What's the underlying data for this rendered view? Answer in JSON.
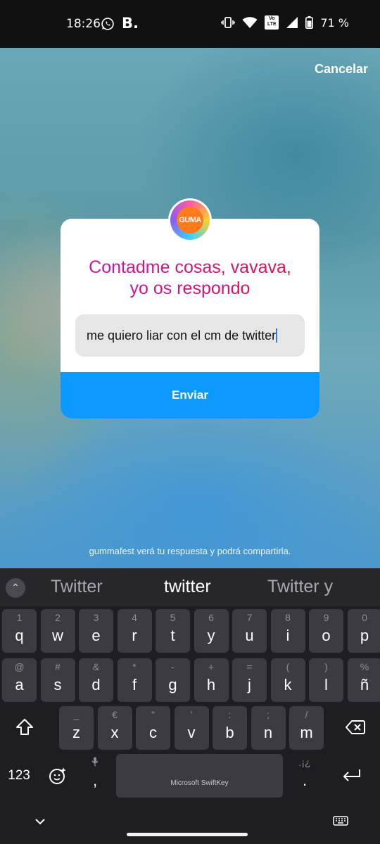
{
  "status_bar": {
    "time": "18:26",
    "notif_b": "B.",
    "volte": "Vo LTE",
    "battery": "71 %",
    "icons": [
      "whatsapp-icon",
      "vibrate-icon",
      "wifi-icon",
      "volte-icon",
      "signal-icon",
      "battery-icon"
    ]
  },
  "story": {
    "cancel_label": "Cancelar",
    "avatar_text": "GUMA",
    "question": "Contadme cosas, vavava, yo os respondo",
    "answer_value": "me quiero liar con el cm de twitter",
    "send_label": "Enviar",
    "footnote": "gummafest verá tu respuesta y podrá compartirla.",
    "colors": {
      "send": "#0d99ff",
      "question_start": "#c016b8",
      "question_end": "#e0133d"
    }
  },
  "keyboard": {
    "suggestions": [
      "Twitter",
      "twitter",
      "Twitter y"
    ],
    "row1": [
      {
        "hint": "1",
        "key": "q"
      },
      {
        "hint": "2",
        "key": "w"
      },
      {
        "hint": "3",
        "key": "e"
      },
      {
        "hint": "4",
        "key": "r"
      },
      {
        "hint": "5",
        "key": "t"
      },
      {
        "hint": "6",
        "key": "y"
      },
      {
        "hint": "7",
        "key": "u"
      },
      {
        "hint": "8",
        "key": "i"
      },
      {
        "hint": "9",
        "key": "o"
      },
      {
        "hint": "0",
        "key": "p"
      }
    ],
    "row2": [
      {
        "hint": "@",
        "key": "a"
      },
      {
        "hint": "#",
        "key": "s"
      },
      {
        "hint": "&",
        "key": "d"
      },
      {
        "hint": "*",
        "key": "f"
      },
      {
        "hint": "-",
        "key": "g"
      },
      {
        "hint": "+",
        "key": "h"
      },
      {
        "hint": "=",
        "key": "j"
      },
      {
        "hint": "(",
        "key": "k"
      },
      {
        "hint": ")",
        "key": "l"
      },
      {
        "hint": "%",
        "key": "ñ"
      }
    ],
    "row3": [
      {
        "hint": "_",
        "key": "z"
      },
      {
        "hint": "€",
        "key": "x"
      },
      {
        "hint": "\"",
        "key": "c"
      },
      {
        "hint": "'",
        "key": "v"
      },
      {
        "hint": ":",
        "key": "b"
      },
      {
        "hint": ";",
        "key": "n"
      },
      {
        "hint": "/",
        "key": "m"
      }
    ],
    "numbers_label": "123",
    "comma_hint": "🎤",
    "comma": ",",
    "space_label": "Microsoft SwiftKey",
    "period_hint": ".¡¿",
    "period": "."
  }
}
